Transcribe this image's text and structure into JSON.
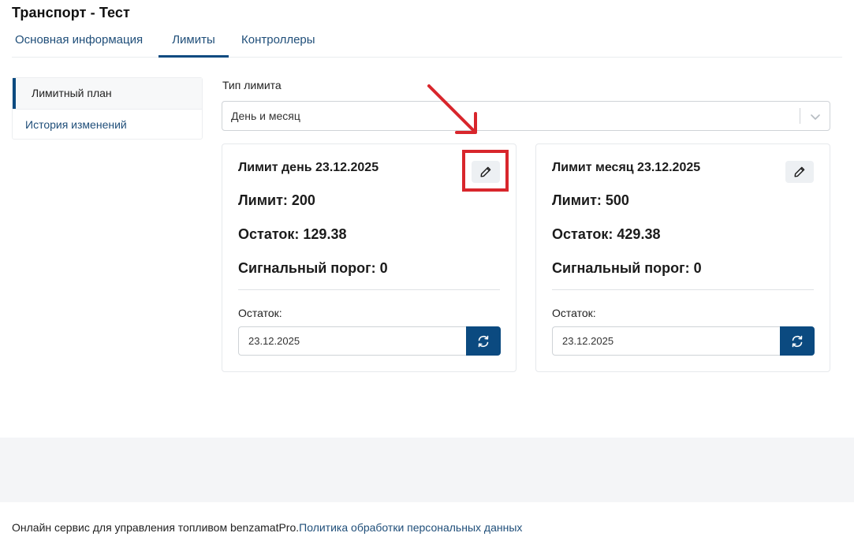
{
  "page": {
    "title": "Транспорт - Тест"
  },
  "tabs": [
    {
      "label": "Основная информация",
      "active": false
    },
    {
      "label": "Лимиты",
      "active": true
    },
    {
      "label": "Контроллеры",
      "active": false
    }
  ],
  "sidebar": {
    "items": [
      {
        "label": "Лимитный план",
        "active": true
      },
      {
        "label": "История изменений",
        "active": false
      }
    ]
  },
  "limit_type": {
    "label": "Тип лимита",
    "value": "День и месяц"
  },
  "cards": [
    {
      "title": "Лимит день 23.12.2025",
      "limit": "Лимит: 200",
      "rest": "Остаток: 129.38",
      "threshold": "Сигнальный порог: 0",
      "rest_label": "Остаток:",
      "date_value": "23.12.2025"
    },
    {
      "title": "Лимит месяц 23.12.2025",
      "limit": "Лимит: 500",
      "rest": "Остаток: 429.38",
      "threshold": "Сигнальный порог: 0",
      "rest_label": "Остаток:",
      "date_value": "23.12.2025"
    }
  ],
  "footer": {
    "text": "Онлайн сервис для управления топливом benzamatPro.",
    "link": "Политика обработки персональных данных"
  },
  "icons": {
    "edit": "pencil-icon",
    "refresh": "refresh-icon",
    "dropdown": "chevron-down-icon",
    "annotation_arrow": "arrow-down-right-icon"
  },
  "colors": {
    "primary": "#0b4a80",
    "link": "#1f4e79",
    "annotation": "#d8262c"
  }
}
